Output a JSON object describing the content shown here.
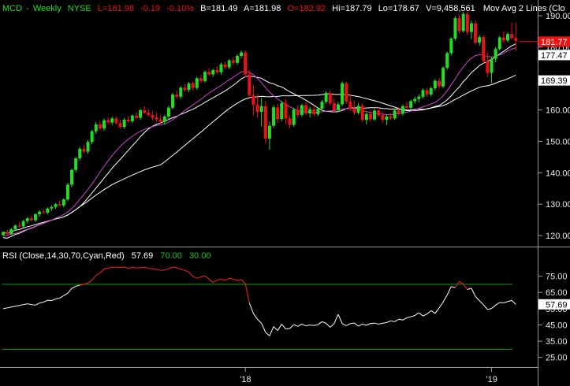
{
  "header": {
    "symbol": "MCD",
    "period": "Weekly",
    "exchange": "NYSE",
    "last": "L=181.98",
    "change": "-0.19",
    "change_pct": "-0.10%",
    "bid": "B=181.49",
    "ask": "A=181.98",
    "open": "O=182.92",
    "high": "Hi=187.79",
    "low": "Lo=178.67",
    "volume": "V=9,458,561",
    "ma_label": "Mov Avg 2 Lines (Clo"
  },
  "rsi_header": {
    "label": "RSI (Close,14,30,70,Cyan,Red)",
    "value": "57.69",
    "upper": "70.00",
    "lower": "30.00"
  },
  "colors": {
    "up": "#22dd22",
    "down": "#ee1111",
    "ma_short": "#cc44cc",
    "ma_mid": "#ffffff",
    "ma_long": "#ffffff",
    "rsi_normal": "#ffffff",
    "rsi_high": "#ff2020",
    "rsi_band": "#1f9a1f",
    "axis_text": "#e6e6e6"
  },
  "price_tags": [
    {
      "value": 181.77,
      "text": "181.77",
      "bg": "#ee1111",
      "fg": "#ffffff"
    },
    {
      "value": 177.47,
      "text": "177.47",
      "bg": "#ffffff",
      "fg": "#000000"
    },
    {
      "value": 169.39,
      "text": "169.39",
      "bg": "#ffffff",
      "fg": "#000000"
    }
  ],
  "rsi_tag": {
    "value": 57.69,
    "text": "57.69"
  },
  "chart_data": [
    {
      "type": "candlestick",
      "title": "MCD Weekly NYSE",
      "ylim": [
        117,
        193
      ],
      "y_ticks": [
        120,
        130,
        140,
        150,
        160,
        170,
        180,
        190
      ],
      "y_tick_labels": [
        "120.00",
        "130.00",
        "140.00",
        "150.00",
        "160.00",
        "170.00",
        "180.00",
        "190.00"
      ],
      "x_tick_labels": [
        "'18",
        "'19"
      ],
      "x_tick_index": [
        60,
        121
      ],
      "grid": false,
      "candles": [
        [
          120.2,
          121.4,
          119.8,
          121.1
        ],
        [
          121.1,
          121.8,
          120.0,
          120.5
        ],
        [
          120.5,
          122.4,
          120.1,
          122.0
        ],
        [
          122.0,
          123.6,
          121.4,
          123.2
        ],
        [
          123.2,
          124.3,
          122.5,
          122.9
        ],
        [
          122.9,
          125.0,
          122.4,
          124.6
        ],
        [
          124.6,
          125.9,
          123.8,
          125.5
        ],
        [
          125.5,
          126.4,
          124.6,
          124.9
        ],
        [
          124.9,
          127.2,
          124.3,
          126.8
        ],
        [
          126.8,
          128.1,
          126.0,
          127.6
        ],
        [
          127.6,
          128.5,
          126.9,
          127.3
        ],
        [
          127.3,
          129.0,
          126.7,
          128.6
        ],
        [
          128.6,
          129.7,
          127.9,
          129.1
        ],
        [
          129.1,
          130.4,
          128.5,
          130.0
        ],
        [
          130.0,
          131.2,
          129.4,
          129.6
        ],
        [
          129.6,
          131.8,
          129.0,
          131.5
        ],
        [
          131.5,
          136.8,
          131.0,
          136.2
        ],
        [
          136.2,
          141.3,
          135.4,
          140.9
        ],
        [
          140.9,
          145.0,
          140.2,
          144.6
        ],
        [
          144.6,
          148.2,
          143.9,
          147.6
        ],
        [
          147.6,
          148.9,
          146.2,
          146.7
        ],
        [
          146.7,
          150.4,
          146.0,
          149.8
        ],
        [
          149.8,
          153.7,
          149.1,
          153.2
        ],
        [
          153.2,
          156.1,
          152.4,
          155.4
        ],
        [
          155.4,
          156.5,
          153.6,
          154.1
        ],
        [
          154.1,
          157.2,
          153.5,
          156.7
        ],
        [
          156.7,
          157.6,
          155.5,
          156.0
        ],
        [
          156.0,
          157.8,
          155.2,
          157.3
        ],
        [
          157.3,
          158.0,
          155.4,
          155.8
        ],
        [
          155.8,
          156.9,
          154.2,
          154.6
        ],
        [
          154.6,
          157.4,
          154.0,
          156.9
        ],
        [
          156.9,
          158.1,
          155.9,
          156.4
        ],
        [
          156.4,
          158.6,
          155.8,
          158.2
        ],
        [
          158.2,
          159.3,
          157.0,
          157.5
        ],
        [
          157.5,
          160.4,
          156.8,
          159.9
        ],
        [
          159.9,
          161.2,
          158.6,
          159.1
        ],
        [
          159.1,
          160.2,
          157.9,
          158.4
        ],
        [
          158.4,
          159.6,
          156.8,
          157.6
        ],
        [
          157.6,
          159.1,
          156.3,
          157.0
        ],
        [
          157.0,
          158.3,
          155.6,
          156.2
        ],
        [
          156.2,
          158.4,
          155.4,
          157.9
        ],
        [
          157.9,
          161.3,
          157.2,
          160.7
        ],
        [
          160.7,
          165.5,
          160.1,
          164.9
        ],
        [
          164.9,
          166.3,
          163.5,
          164.2
        ],
        [
          164.2,
          167.6,
          163.5,
          167.1
        ],
        [
          167.1,
          168.3,
          165.8,
          166.4
        ],
        [
          166.4,
          168.9,
          165.7,
          168.4
        ],
        [
          168.4,
          169.1,
          166.2,
          167.0
        ],
        [
          167.0,
          170.6,
          166.4,
          170.1
        ],
        [
          170.1,
          171.2,
          168.5,
          169.2
        ],
        [
          169.2,
          172.6,
          168.7,
          172.1
        ],
        [
          172.1,
          173.4,
          170.8,
          171.3
        ],
        [
          171.3,
          173.1,
          170.6,
          172.7
        ],
        [
          172.7,
          173.9,
          171.4,
          172.0
        ],
        [
          172.0,
          175.1,
          171.2,
          174.5
        ],
        [
          174.5,
          175.4,
          173.0,
          173.6
        ],
        [
          173.6,
          176.2,
          172.9,
          175.8
        ],
        [
          175.8,
          176.9,
          174.3,
          175.0
        ],
        [
          175.0,
          177.8,
          174.4,
          177.2
        ],
        [
          177.2,
          178.9,
          176.5,
          178.3
        ],
        [
          178.3,
          179.0,
          170.5,
          171.3
        ],
        [
          171.3,
          172.6,
          163.9,
          164.7
        ],
        [
          164.7,
          168.0,
          158.2,
          161.6
        ],
        [
          161.6,
          165.1,
          157.6,
          159.4
        ],
        [
          159.4,
          163.8,
          154.7,
          161.2
        ],
        [
          161.2,
          162.9,
          149.3,
          150.9
        ],
        [
          150.9,
          156.2,
          147.4,
          155.0
        ],
        [
          155.0,
          161.5,
          154.2,
          160.8
        ],
        [
          160.8,
          161.9,
          155.9,
          157.1
        ],
        [
          157.1,
          162.8,
          156.4,
          162.2
        ],
        [
          162.2,
          163.4,
          155.6,
          157.3
        ],
        [
          157.3,
          158.2,
          154.1,
          155.2
        ],
        [
          155.2,
          160.7,
          154.6,
          160.1
        ],
        [
          160.1,
          161.6,
          157.5,
          158.4
        ],
        [
          158.4,
          162.0,
          157.8,
          161.5
        ],
        [
          161.5,
          162.4,
          158.2,
          158.9
        ],
        [
          158.9,
          161.0,
          157.6,
          160.2
        ],
        [
          160.2,
          161.1,
          157.9,
          158.6
        ],
        [
          158.6,
          160.9,
          158.0,
          160.4
        ],
        [
          160.4,
          163.2,
          159.8,
          162.6
        ],
        [
          162.6,
          166.0,
          162.0,
          165.4
        ],
        [
          165.4,
          166.2,
          161.4,
          162.1
        ],
        [
          162.1,
          163.6,
          159.2,
          159.9
        ],
        [
          159.9,
          162.5,
          159.3,
          161.8
        ],
        [
          161.8,
          169.1,
          161.2,
          168.5
        ],
        [
          168.5,
          169.0,
          161.9,
          162.7
        ],
        [
          162.7,
          165.0,
          159.6,
          160.3
        ],
        [
          160.3,
          163.1,
          158.6,
          159.1
        ],
        [
          159.1,
          162.1,
          158.5,
          161.3
        ],
        [
          161.3,
          162.0,
          156.0,
          156.8
        ],
        [
          156.8,
          159.2,
          155.4,
          158.7
        ],
        [
          158.7,
          159.9,
          156.2,
          157.0
        ],
        [
          157.0,
          160.3,
          156.5,
          159.8
        ],
        [
          159.8,
          160.8,
          157.6,
          158.3
        ],
        [
          158.3,
          159.6,
          155.9,
          156.9
        ],
        [
          156.9,
          158.4,
          155.2,
          157.9
        ],
        [
          157.9,
          159.0,
          156.8,
          157.3
        ],
        [
          157.3,
          160.4,
          156.8,
          159.8
        ],
        [
          159.8,
          160.9,
          158.2,
          158.8
        ],
        [
          158.8,
          161.7,
          158.2,
          161.2
        ],
        [
          161.2,
          162.6,
          160.1,
          160.7
        ],
        [
          160.7,
          163.3,
          160.0,
          162.8
        ],
        [
          162.8,
          164.2,
          162.0,
          163.5
        ],
        [
          163.5,
          165.0,
          162.4,
          164.2
        ],
        [
          164.2,
          166.8,
          163.7,
          166.3
        ],
        [
          166.3,
          167.1,
          164.2,
          164.9
        ],
        [
          164.9,
          167.4,
          164.3,
          166.9
        ],
        [
          166.9,
          169.8,
          166.2,
          169.3
        ],
        [
          169.3,
          170.2,
          166.6,
          167.5
        ],
        [
          167.5,
          173.9,
          166.9,
          173.4
        ],
        [
          173.4,
          178.6,
          172.8,
          178.1
        ],
        [
          178.1,
          183.2,
          177.4,
          182.7
        ],
        [
          182.7,
          189.8,
          182.1,
          189.2
        ],
        [
          189.2,
          190.4,
          184.3,
          185.1
        ],
        [
          185.1,
          191.2,
          184.6,
          190.6
        ],
        [
          190.6,
          191.4,
          183.9,
          184.8
        ],
        [
          184.8,
          188.4,
          182.6,
          187.6
        ],
        [
          187.6,
          188.6,
          180.7,
          181.4
        ],
        [
          181.4,
          183.9,
          180.4,
          183.2
        ],
        [
          183.2,
          183.8,
          174.9,
          175.6
        ],
        [
          175.6,
          178.2,
          170.6,
          171.8
        ],
        [
          171.8,
          176.9,
          168.5,
          176.3
        ],
        [
          176.3,
          180.0,
          175.2,
          179.4
        ],
        [
          179.4,
          183.6,
          178.9,
          183.1
        ],
        [
          183.1,
          184.9,
          181.2,
          182.1
        ],
        [
          182.1,
          184.7,
          181.5,
          184.2
        ],
        [
          184.2,
          187.8,
          182.4,
          182.9
        ],
        [
          182.9,
          187.8,
          178.7,
          182.0
        ]
      ],
      "ma_short": [
        119.8,
        120.1,
        120.4,
        120.7,
        121.1,
        121.6,
        122.0,
        122.5,
        122.9,
        123.4,
        123.9,
        124.4,
        124.9,
        125.5,
        126.1,
        126.7,
        127.5,
        128.6,
        130.0,
        131.6,
        133.1,
        134.7,
        136.4,
        138.3,
        140.2,
        142.0,
        143.8,
        145.5,
        147.0,
        148.4,
        149.6,
        150.7,
        151.6,
        152.5,
        153.2,
        153.8,
        154.3,
        154.7,
        155.0,
        155.3,
        155.6,
        156.1,
        156.9,
        157.8,
        158.8,
        159.8,
        160.7,
        161.6,
        162.5,
        163.4,
        164.4,
        165.3,
        166.2,
        167.0,
        167.8,
        168.7,
        169.6,
        170.4,
        171.3,
        172.1,
        172.3,
        172.0,
        171.2,
        170.0,
        168.7,
        167.1,
        165.7,
        164.5,
        163.5,
        162.6,
        161.8,
        161.0,
        160.4,
        159.8,
        159.5,
        159.3,
        159.2,
        159.2,
        159.3,
        159.4,
        159.6,
        159.7,
        159.8,
        160.1,
        160.3,
        160.4,
        160.5,
        160.5,
        160.2,
        159.8,
        159.5,
        159.2,
        159.0,
        158.8,
        158.6,
        158.5,
        158.5,
        158.6,
        158.8,
        159.0,
        159.3,
        159.6,
        160.0,
        160.5,
        161.0,
        161.4,
        161.9,
        162.4,
        163.3,
        164.5,
        166.1,
        168.0,
        169.9,
        172.0,
        173.7,
        175.3,
        176.5,
        177.3,
        177.6,
        177.4,
        177.0,
        176.9,
        177.1,
        177.5,
        178.0,
        178.8,
        179.4,
        179.8
      ]
    },
    {
      "type": "line",
      "title": "RSI (Close,14,30,70,Cyan,Red)",
      "ylim": [
        20,
        85
      ],
      "y_ticks": [
        25,
        35,
        45,
        55,
        65,
        75
      ],
      "y_tick_labels": [
        "25.00",
        "35.00",
        "45.00",
        "55.00",
        "65.00",
        "75.00"
      ],
      "levels": [
        30,
        70
      ],
      "grid": false,
      "values": [
        55,
        55.5,
        56,
        56.5,
        57,
        57.5,
        58,
        57.5,
        57.2,
        58.5,
        59,
        60.2,
        60,
        61,
        61.5,
        63,
        64.5,
        67.5,
        68.8,
        69.5,
        70,
        70.8,
        72.5,
        75.5,
        77,
        79.5,
        80,
        80.5,
        80.6,
        80.4,
        80.7,
        79.8,
        80.5,
        80.1,
        80.2,
        80.4,
        80,
        79.5,
        79.1,
        78.6,
        78.8,
        79.6,
        80.7,
        80.2,
        79.3,
        78.6,
        77.5,
        74.8,
        73.8,
        74.5,
        75.1,
        73.3,
        71.2,
        72.6,
        73.1,
        72.5,
        73.7,
        73.2,
        72.4,
        72.8,
        70.5,
        58.5,
        52,
        48.5,
        46,
        40.5,
        38.2,
        44,
        41.5,
        45.5,
        42.5,
        42.8,
        45.2,
        44.1,
        45.5,
        44.4,
        45,
        44.6,
        45.2,
        47,
        46,
        43.5,
        45.8,
        51.5,
        45.8,
        44.5,
        45.8,
        46.2,
        44.2,
        45.5,
        44.8,
        45.9,
        46.1,
        45.5,
        46,
        46.5,
        47.5,
        47,
        48.5,
        48,
        49.3,
        50.1,
        50.8,
        52.5,
        50.5,
        51.7,
        53.8,
        52.1,
        55.4,
        59.1,
        63.4,
        68.6,
        68,
        71.9,
        70.1,
        66.8,
        67.6,
        62.5,
        59.9,
        57.4,
        54.5,
        55.1,
        57.2,
        58.8,
        58.6,
        59.4,
        60.1,
        57.69
      ]
    }
  ]
}
